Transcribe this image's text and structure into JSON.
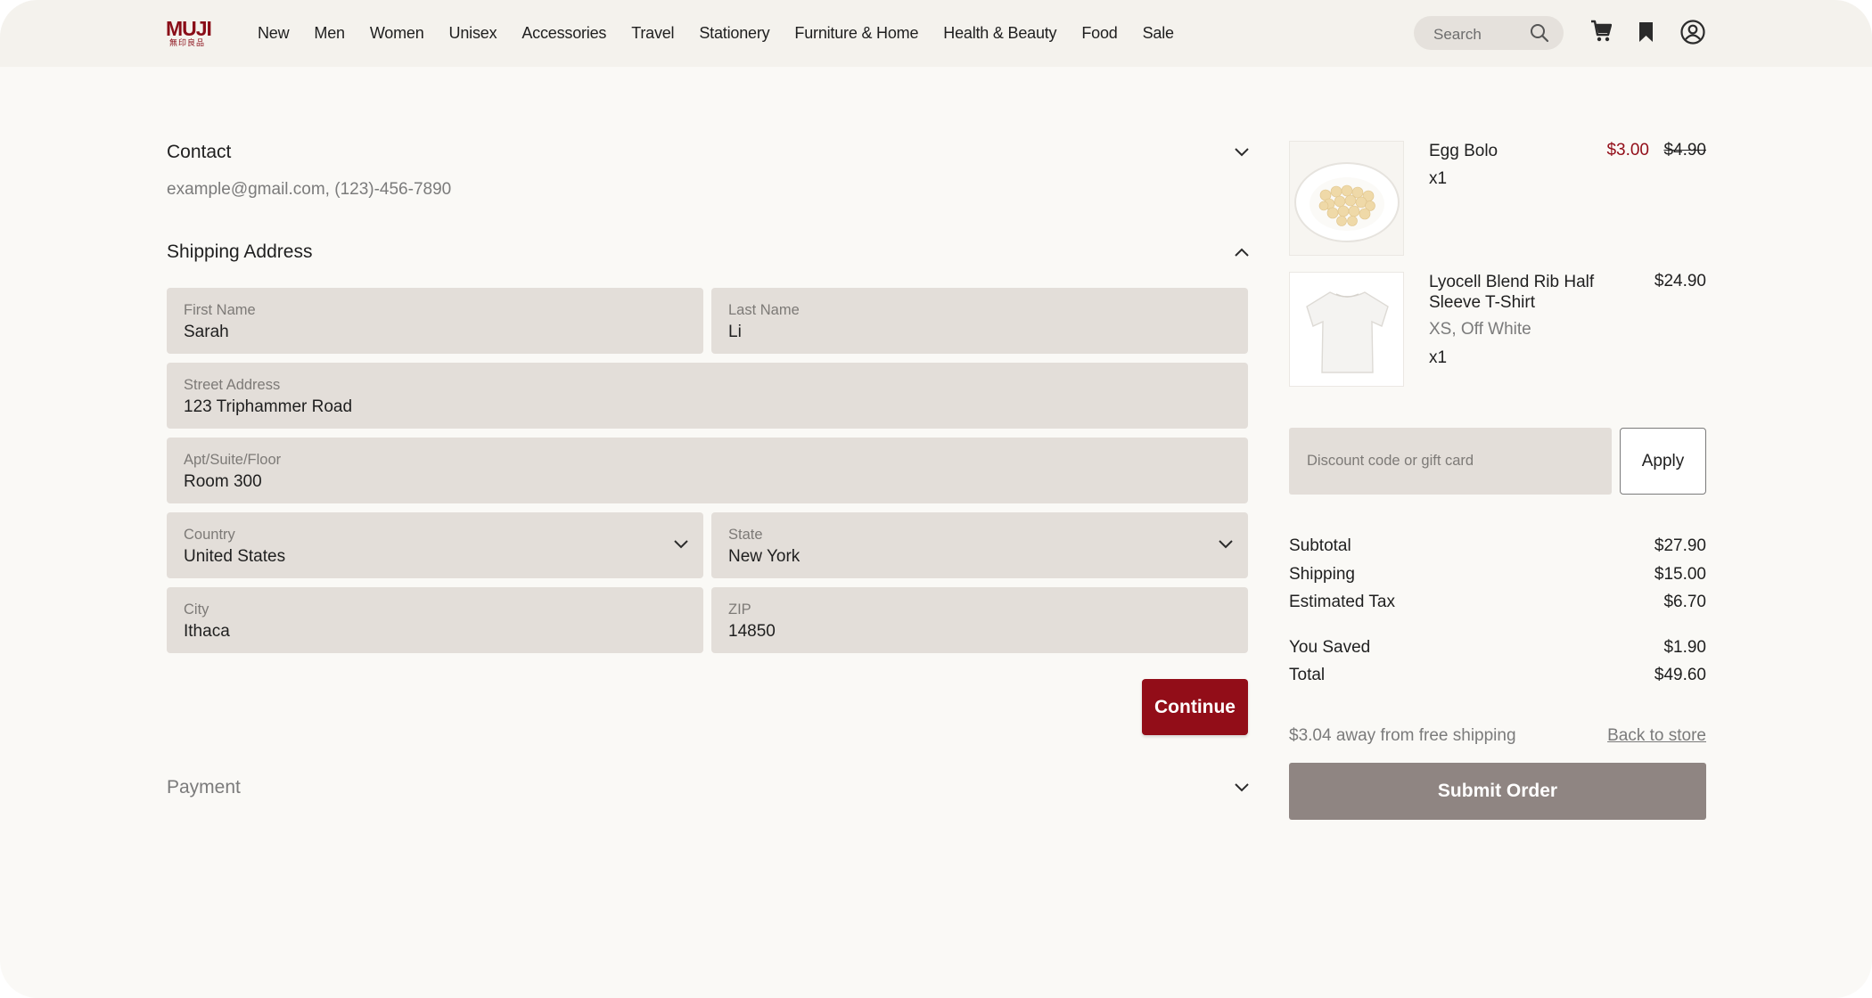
{
  "header": {
    "logo_text": "MUJI",
    "logo_subtext": "無印良品",
    "nav": [
      "New",
      "Men",
      "Women",
      "Unisex",
      "Accessories",
      "Travel",
      "Stationery",
      "Furniture & Home",
      "Health & Beauty",
      "Food",
      "Sale"
    ],
    "search_placeholder": "Search",
    "icons": [
      "search-icon",
      "cart-icon",
      "bookmark-icon",
      "account-icon"
    ]
  },
  "checkout": {
    "contact": {
      "title": "Contact",
      "info": "example@gmail.com, (123)-456-7890",
      "state": "collapsed"
    },
    "shipping": {
      "title": "Shipping Address",
      "state": "expanded",
      "fields": {
        "first_name": {
          "label": "First Name",
          "value": "Sarah"
        },
        "last_name": {
          "label": "Last Name",
          "value": "Li"
        },
        "street": {
          "label": "Street Address",
          "value": "123 Triphammer Road"
        },
        "apt": {
          "label": "Apt/Suite/Floor",
          "value": "Room 300"
        },
        "country": {
          "label": "Country",
          "value": "United States"
        },
        "state": {
          "label": "State",
          "value": "New York"
        },
        "city": {
          "label": "City",
          "value": "Ithaca"
        },
        "zip": {
          "label": "ZIP",
          "value": "14850"
        }
      },
      "continue_label": "Continue"
    },
    "payment": {
      "title": "Payment",
      "state": "collapsed"
    }
  },
  "order": {
    "items": [
      {
        "name": "Egg Bolo",
        "options": "",
        "qty": "x1",
        "sale_price": "$3.00",
        "original_price": "$4.90"
      },
      {
        "name": "Lyocell Blend Rib Half Sleeve T-Shirt",
        "options": "XS, Off White",
        "qty": "x1",
        "price": "$24.90"
      }
    ],
    "discount_placeholder": "Discount code or gift card",
    "apply_label": "Apply",
    "summary": {
      "subtotal_label": "Subtotal",
      "subtotal": "$27.90",
      "shipping_label": "Shipping",
      "shipping": "$15.00",
      "tax_label": "Estimated Tax",
      "tax": "$6.70",
      "saved_label": "You Saved",
      "saved": "$1.90",
      "total_label": "Total",
      "total": "$49.60"
    },
    "free_shipping_note": "$3.04 away from free shipping",
    "back_label": "Back to store",
    "submit_label": "Submit Order"
  },
  "colors": {
    "brand_red": "#920d18",
    "field_bg": "#e3ded9",
    "page_bg": "#faf9f6",
    "header_bg": "#f4f2ed",
    "submit_disabled": "#8f8582"
  }
}
